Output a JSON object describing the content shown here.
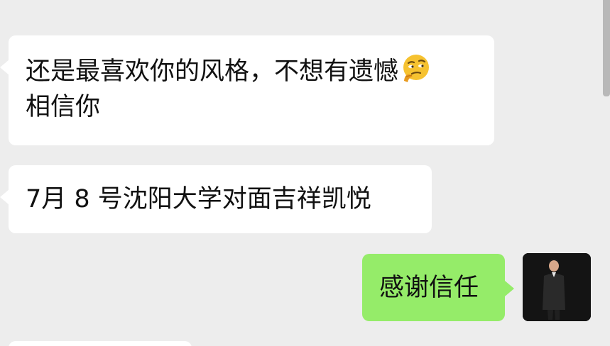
{
  "messages": [
    {
      "direction": "incoming",
      "line1": "还是最喜欢你的风格，不想有遗憾",
      "emoji": "thinking-face-emoji",
      "line2": "相信你"
    },
    {
      "direction": "incoming",
      "text": "7月 8 号沈阳大学对面吉祥凯悦"
    },
    {
      "direction": "outgoing",
      "text": "感谢信任"
    }
  ],
  "colors": {
    "background": "#ededed",
    "incoming_bubble": "#ffffff",
    "outgoing_bubble": "#95ec69"
  }
}
